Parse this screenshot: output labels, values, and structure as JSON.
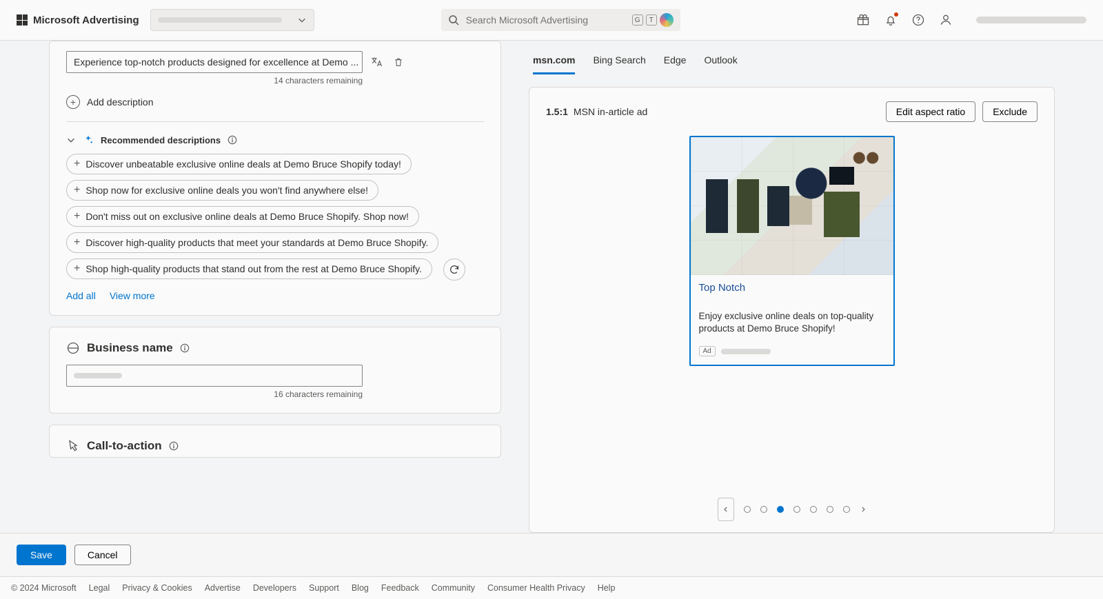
{
  "header": {
    "brand": "Microsoft Advertising",
    "search_placeholder": "Search Microsoft Advertising",
    "kbd1": "G",
    "kbd2": "T"
  },
  "descriptions": {
    "input_value": "Experience top-notch products designed for excellence at Demo ...",
    "char_remaining": "14 characters remaining",
    "add_label": "Add description",
    "rec_title": "Recommended descriptions",
    "pills": [
      "Discover unbeatable exclusive online deals at Demo Bruce Shopify today!",
      "Shop now for exclusive online deals you won't find anywhere else!",
      "Don't miss out on exclusive online deals at Demo Bruce Shopify. Shop now!",
      "Discover high-quality products that meet your standards at Demo Bruce Shopify.",
      "Shop high-quality products that stand out from the rest at Demo Bruce Shopify."
    ],
    "add_all": "Add all",
    "view_more": "View more"
  },
  "business": {
    "title": "Business name",
    "char_remaining": "16 characters remaining"
  },
  "cta": {
    "title": "Call-to-action"
  },
  "preview": {
    "tabs": [
      "msn.com",
      "Bing Search",
      "Edge",
      "Outlook"
    ],
    "ratio": "1.5:1",
    "ratio_label": "MSN in-article ad",
    "edit_btn": "Edit aspect ratio",
    "exclude_btn": "Exclude",
    "ad_title": "Top Notch",
    "ad_desc": "Enjoy exclusive online deals on top-quality products at Demo Bruce Shopify!",
    "ad_badge": "Ad",
    "active_dot_index": 2,
    "dot_count": 7
  },
  "actions": {
    "save": "Save",
    "cancel": "Cancel"
  },
  "footer": {
    "copyright": "© 2024 Microsoft",
    "links": [
      "Legal",
      "Privacy & Cookies",
      "Advertise",
      "Developers",
      "Support",
      "Blog",
      "Feedback",
      "Community",
      "Consumer Health Privacy",
      "Help"
    ]
  }
}
